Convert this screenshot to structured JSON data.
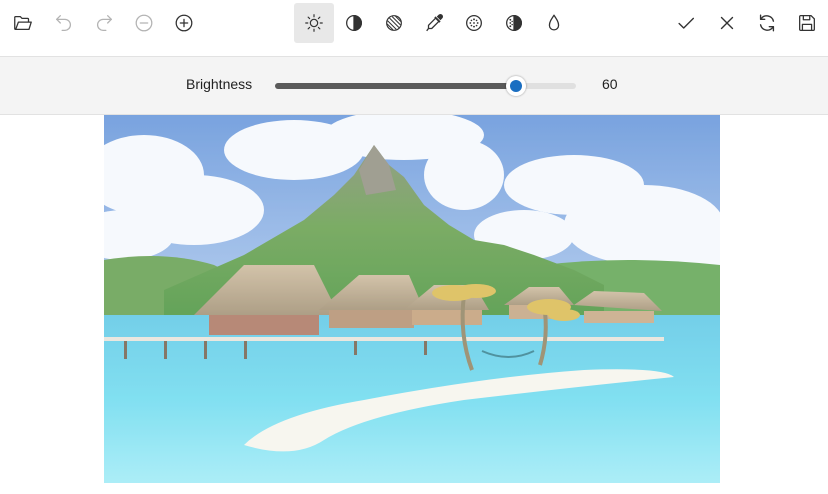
{
  "toolbar": {
    "left_tools": [
      {
        "name": "open-folder-icon",
        "enabled": true
      },
      {
        "name": "undo-icon",
        "enabled": false
      },
      {
        "name": "redo-icon",
        "enabled": false
      },
      {
        "name": "zoom-out-icon",
        "enabled": false
      },
      {
        "name": "zoom-in-icon",
        "enabled": true
      }
    ],
    "filter_tools": [
      {
        "name": "brightness-icon",
        "active": true
      },
      {
        "name": "contrast-icon",
        "active": false
      },
      {
        "name": "saturation-icon",
        "active": false
      },
      {
        "name": "eyedropper-icon",
        "active": false
      },
      {
        "name": "blur-icon",
        "active": false
      },
      {
        "name": "sharpen-icon",
        "active": false
      },
      {
        "name": "droplet-icon",
        "active": false
      }
    ],
    "right_tools": [
      {
        "name": "apply-check-icon"
      },
      {
        "name": "cancel-x-icon"
      },
      {
        "name": "reset-refresh-icon"
      },
      {
        "name": "save-disk-icon"
      }
    ]
  },
  "adjustment": {
    "label": "Brightness",
    "value": "60",
    "fill_fraction": 0.8
  },
  "colors": {
    "icon_enabled": "#333333",
    "icon_disabled": "#b4b4b4",
    "active_bg": "#e8e8e8",
    "slider_thumb": "#1a6ec1",
    "slider_fill": "#5a5a5a"
  }
}
